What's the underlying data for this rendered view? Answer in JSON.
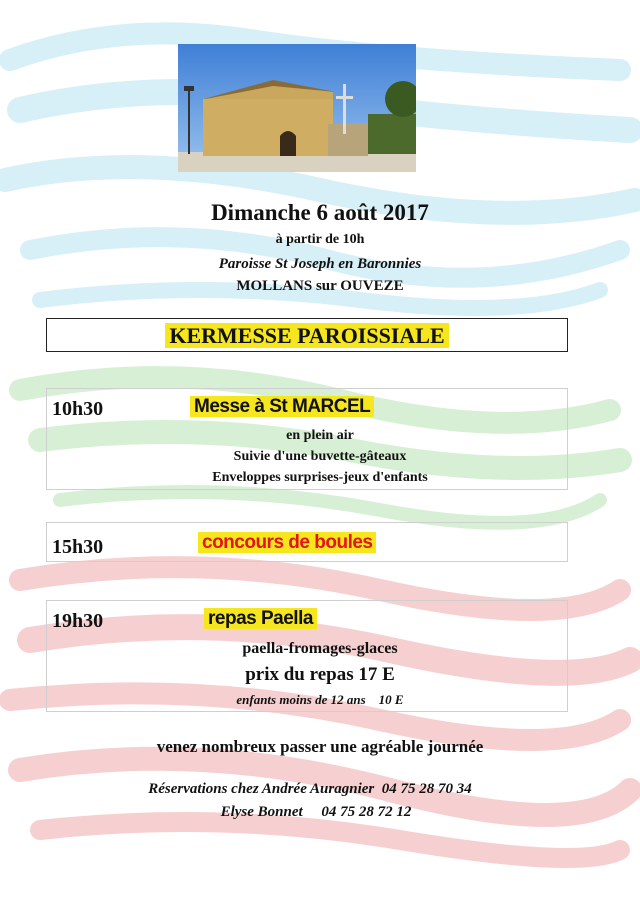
{
  "photo": {
    "description_icon": "chapel-photo-icon"
  },
  "header": {
    "date": "Dimanche 6 août 2017",
    "start": "à partir de 10h",
    "parish": "Paroisse St Joseph en Baronnies",
    "town": "MOLLANS sur OUVEZE"
  },
  "banner": {
    "title": "KERMESSE PAROISSIALE"
  },
  "events": [
    {
      "time": "10h30",
      "title": "Messe à St MARCEL",
      "lines": [
        "en plein air",
        "Suivie d'une buvette-gâteaux",
        "Enveloppes surprises-jeux d'enfants"
      ]
    },
    {
      "time": "15h30",
      "title": "concours de boules"
    },
    {
      "time": "19h30",
      "title": "repas Paella",
      "lines": [
        "paella-fromages-glaces",
        "prix du repas 17 E",
        "enfants moins de 12 ans    10 E"
      ]
    }
  ],
  "invite": "venez nombreux passer une agréable journée",
  "reservations": {
    "line1": "Réservations chez Andrée Auragnier  04 75 28 70 34",
    "line2": "Elyse Bonnet     04 75 28 72 12"
  },
  "colors": {
    "highlight": "#f5e61e",
    "event2_text": "#e4141b",
    "crayon_blue": "#8fd3ea",
    "crayon_green": "#8fd68a",
    "crayon_red": "#e87a7a"
  }
}
